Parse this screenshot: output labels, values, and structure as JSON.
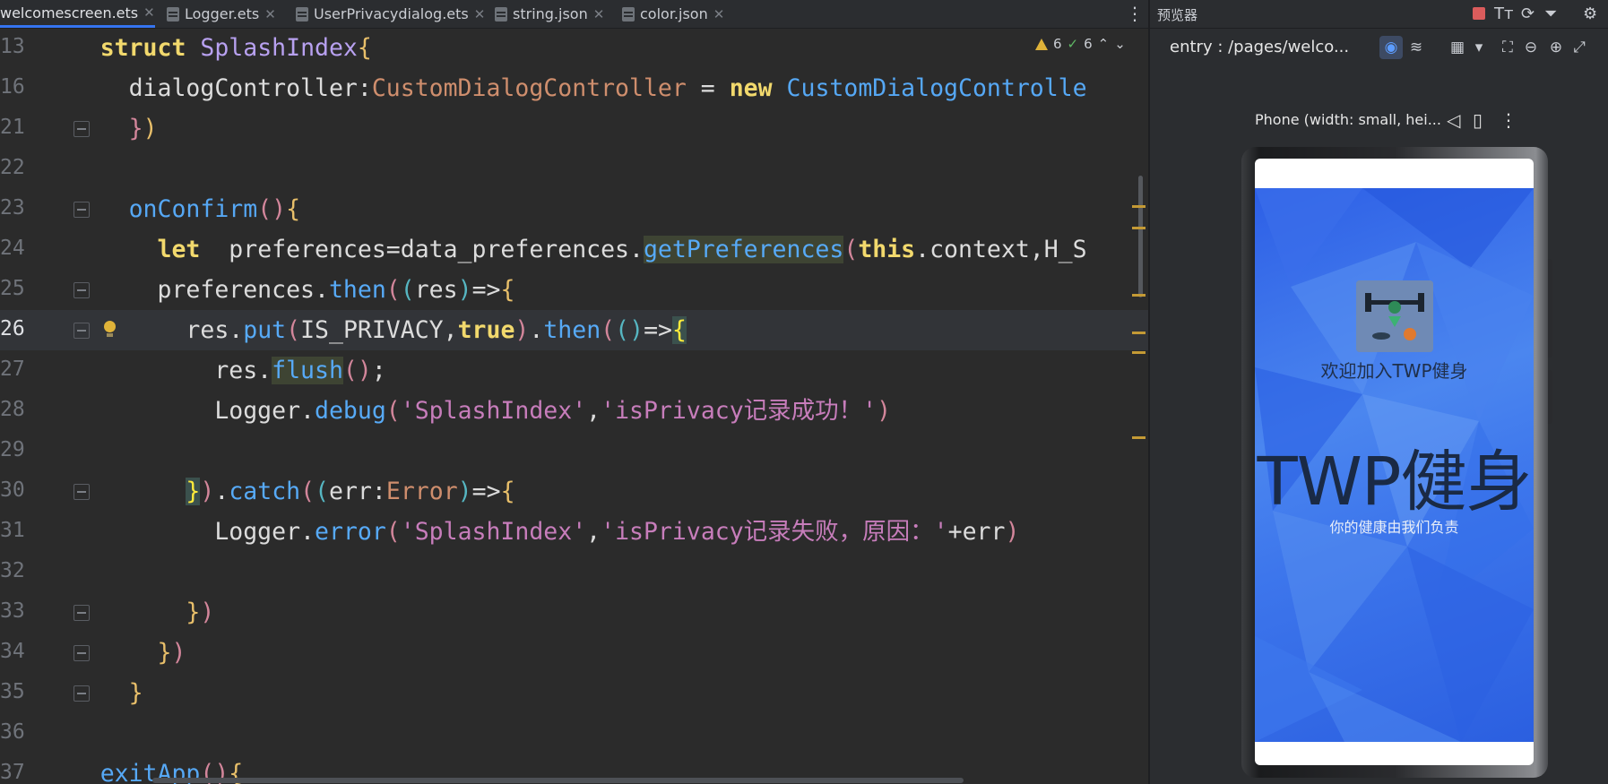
{
  "tabs": [
    {
      "label": "welcomescreen.ets",
      "active": true
    },
    {
      "label": "Logger.ets",
      "active": false
    },
    {
      "label": "UserPrivacydialog.ets",
      "active": false
    },
    {
      "label": "string.json",
      "active": false
    },
    {
      "label": "color.json",
      "active": false
    }
  ],
  "editor": {
    "line_numbers": [
      "13",
      "16",
      "21",
      "22",
      "23",
      "24",
      "25",
      "26",
      "27",
      "28",
      "29",
      "30",
      "31",
      "32",
      "33",
      "34",
      "35",
      "36",
      "37"
    ],
    "inspection": {
      "warnings": "6",
      "weak_warnings": "6"
    }
  },
  "preview": {
    "title": "预览器",
    "path": "entry : /pages/welco...",
    "device": "Phone (width: small, hei...",
    "app": {
      "welcome": "欢迎加入TWP健身",
      "title": "TWP健身",
      "subtitle": "你的健康由我们负责"
    }
  },
  "colors": {
    "editor_bg": "#2b2b2b",
    "keyword": "#f2d96d",
    "function": "#57aaf7",
    "string": "#c77dbb",
    "type": "#cf8e6d",
    "accent": "#3574f0",
    "app_bg": "#3d76ec"
  }
}
